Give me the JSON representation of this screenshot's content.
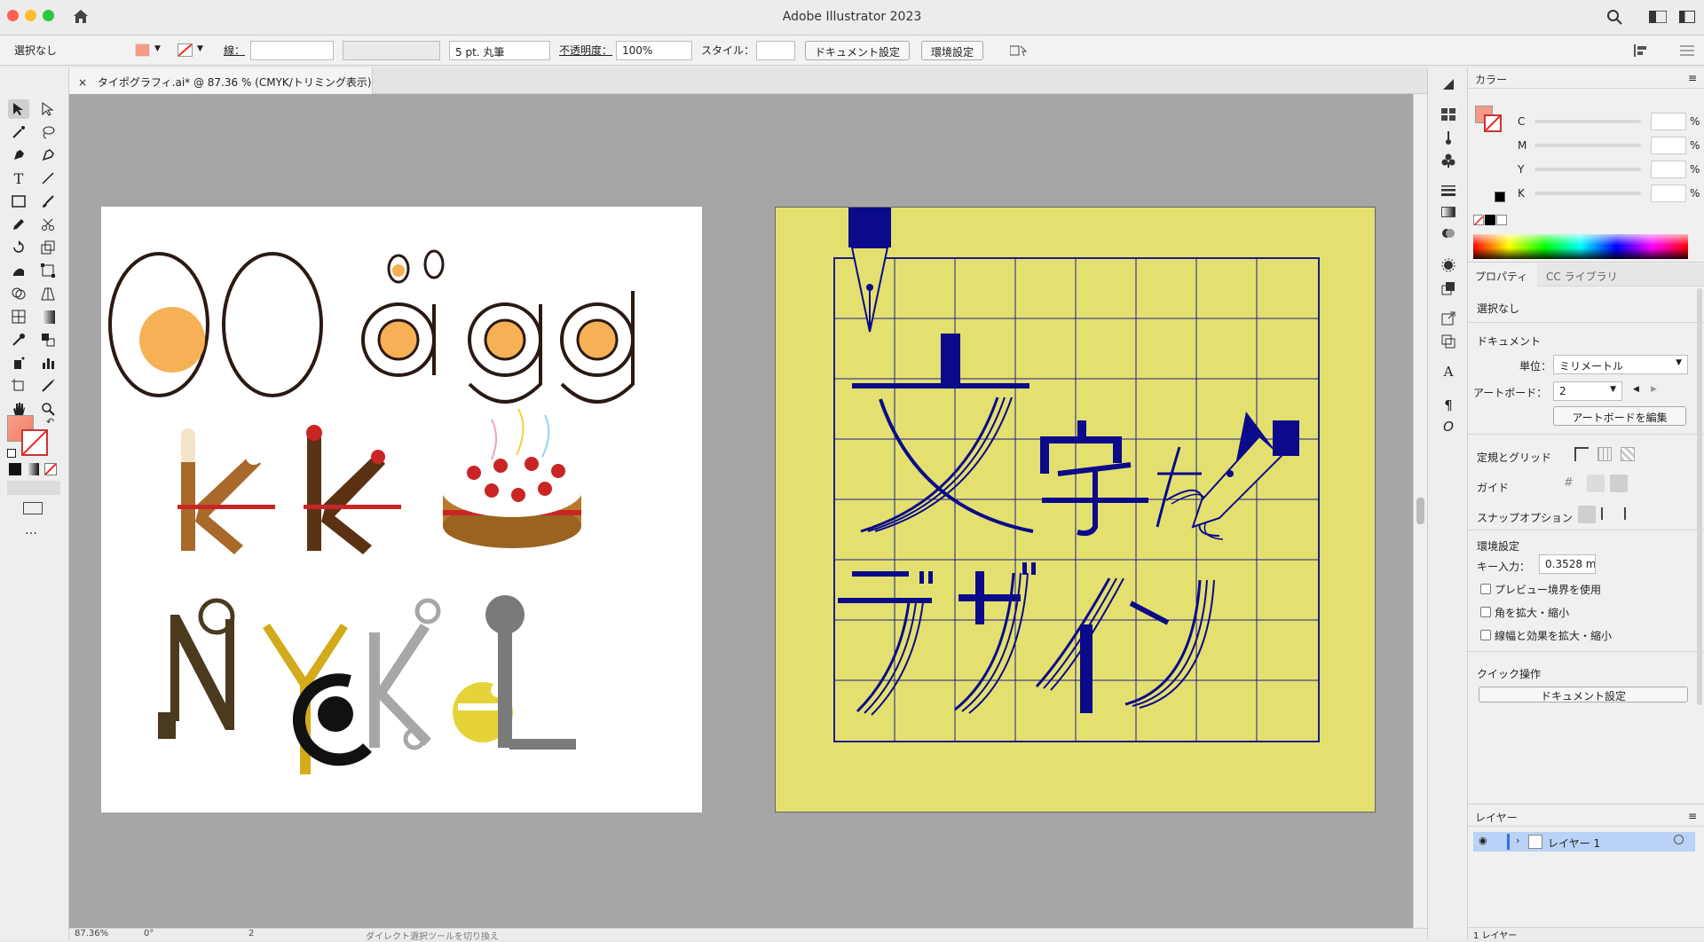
{
  "app": {
    "title": "Adobe Illustrator 2023"
  },
  "control_bar": {
    "selection": "選択なし",
    "stroke_label": "線：",
    "brush": "5 pt. 丸筆",
    "opacity_label": "不透明度：",
    "opacity_value": "100%",
    "style_label": "スタイル：",
    "document_setup_button": "ドキュメント設定",
    "preferences_button": "環境設定"
  },
  "document_tab": {
    "close": "×",
    "label": "タイポグラフィ.ai* @ 87.36 % (CMYK/トリミング表示)"
  },
  "status_bar": {
    "zoom": "87.36%",
    "rotation": "0°",
    "artboard": "2",
    "hint": "ダイレクト選択ツールを切り換え"
  },
  "color_panel": {
    "tab": "カラー",
    "channels": [
      "C",
      "M",
      "Y",
      "K"
    ],
    "percent": "%"
  },
  "properties_panel": {
    "tabs": [
      "プロパティ",
      "CC ライブラリ"
    ],
    "selection": "選択なし",
    "document_header": "ドキュメント",
    "units_label": "単位：",
    "units_value": "ミリメートル",
    "artboard_label": "アートボード：",
    "artboard_value": "2",
    "edit_artboards_button": "アートボードを編集",
    "rulers_grids": "定規とグリッド",
    "guides": "ガイド",
    "snap_options": "スナップオプション",
    "preferences_header": "環境設定",
    "keyboard_increment_label": "キー入力：",
    "keyboard_increment_value": "0.3528 m",
    "checkboxes": [
      "プレビュー境界を使用",
      "角を拡大・縮小",
      "線幅と効果を拡大・縮小"
    ],
    "quick_actions": "クイック操作",
    "quick_document_setup": "ドキュメント設定"
  },
  "layers_panel": {
    "tab": "レイヤー",
    "layer_name": "レイヤー 1",
    "footer_count": "1 レイヤー"
  },
  "artwork": {
    "row1_text": "ägg",
    "row3_text": "NYCKEL",
    "right_title": "文字を\nデザイン",
    "colors": {
      "yellow": "#e4e070",
      "navy": "#0a0a8a",
      "egg": "#f6b055"
    }
  }
}
